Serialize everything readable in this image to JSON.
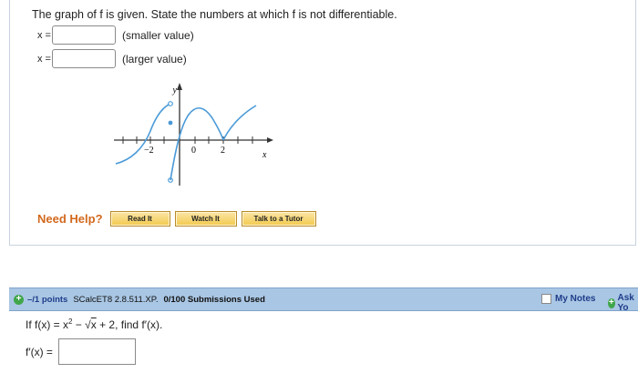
{
  "q1": {
    "prompt": "The graph of f is given. State the numbers at which f is not differentiable.",
    "rows": [
      {
        "label": "x =",
        "value": "",
        "hint": "(smaller value)"
      },
      {
        "label": "x =",
        "value": "",
        "hint": "(larger value)"
      }
    ],
    "graph": {
      "y_label": "y",
      "x_label": "x",
      "tick_neg2": "−2",
      "tick_0": "0",
      "tick_2": "2"
    }
  },
  "help": {
    "title": "Need Help?",
    "buttons": [
      "Read It",
      "Watch It",
      "Talk to a Tutor"
    ]
  },
  "bar": {
    "points": "–/1 points",
    "code": "SCalcET8 2.8.511.XP.",
    "submissions": "0/100 Submissions Used",
    "notes": "My Notes",
    "ask": "Ask Yo"
  },
  "q2": {
    "prefix": "If f(x) = x",
    "exp": "2",
    "minus": " − √",
    "radicand": "x",
    "suffix": " + 2, find f′(x).",
    "answer_label": "f′(x) =",
    "answer_value": ""
  },
  "colors": {
    "help_title": "#d2691e",
    "bar": "#a9c6e4",
    "accent": "#3fa64a",
    "curve": "#4a9ad8"
  }
}
